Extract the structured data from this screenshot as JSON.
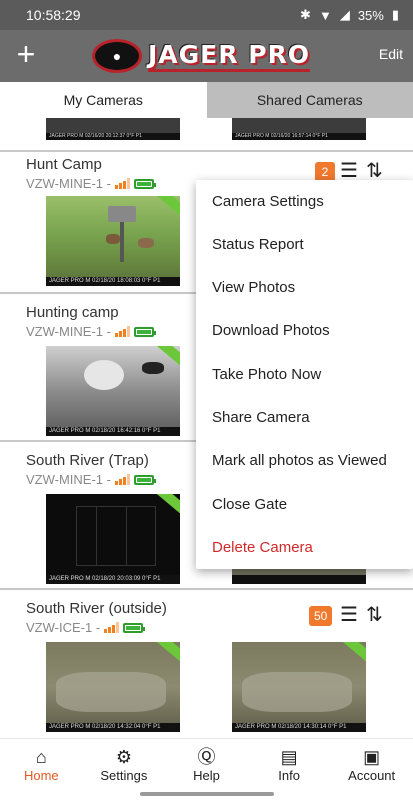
{
  "statusbar": {
    "time": "10:58:29",
    "battery": "35%",
    "icons": [
      "bluetooth-icon",
      "wifi-icon",
      "signal-icon",
      "battery-icon"
    ]
  },
  "header": {
    "add_icon": "+",
    "logo_text": "JAGER PRO",
    "edit_label": "Edit"
  },
  "tabs": [
    {
      "label": "My Cameras",
      "active": true
    },
    {
      "label": "Shared Cameras",
      "active": false
    }
  ],
  "top_thumbs": [
    {
      "caption": "JAGER PRO  M   02/16/20  20:12:37   0°F  P1"
    },
    {
      "caption": "JAGER PRO  M   02/16/20  16:57:14   0°F  P1"
    }
  ],
  "cameras": [
    {
      "name": "Hunt Camp",
      "id": "VZW-MINE-1 -",
      "photo_count": "2",
      "photos": [
        {
          "caption": "JAGER PRO  M   02/18/20  18:08:03   0°F  P1"
        }
      ]
    },
    {
      "name": "Hunting camp",
      "id": "VZW-MINE-1 -",
      "photo_count": "",
      "photos": [
        {
          "caption": "JAGER PRO  M   02/18/20  16:42:16   0°F  P1"
        }
      ]
    },
    {
      "name": "South River (Trap)",
      "id": "VZW-MINE-1 -",
      "photo_count": "",
      "photos": [
        {
          "caption": "JAGER PRO  M   02/18/20  20:03:09   0°F  P1"
        }
      ]
    },
    {
      "name": "South River (outside)",
      "id": "VZW-ICE-1 -",
      "photo_count": "50",
      "photos": [
        {
          "caption": "JAGER PRO  M   02/18/20  14:32:04   0°F  P1"
        },
        {
          "caption": "JAGER PRO  M   02/18/20  14:30:14   0°F  P1"
        }
      ]
    }
  ],
  "menu": {
    "items": [
      {
        "label": "Camera Settings"
      },
      {
        "label": "Status Report"
      },
      {
        "label": "View Photos"
      },
      {
        "label": "Download Photos"
      },
      {
        "label": "Take Photo Now"
      },
      {
        "label": "Share Camera"
      },
      {
        "label": "Mark all photos as Viewed"
      },
      {
        "label": "Close Gate"
      },
      {
        "label": "Delete Camera"
      }
    ],
    "danger_color": "#d02a2a"
  },
  "bottom_nav": [
    {
      "label": "Home",
      "icon": "home-icon",
      "active": true
    },
    {
      "label": "Settings",
      "icon": "gear-icon",
      "active": false
    },
    {
      "label": "Help",
      "icon": "help-icon",
      "active": false
    },
    {
      "label": "Info",
      "icon": "info-icon",
      "active": false
    },
    {
      "label": "Account",
      "icon": "account-icon",
      "active": false
    }
  ],
  "colors": {
    "accent": "#e25b1f",
    "badge": "#f0792d",
    "battery_green": "#3cb43c",
    "signal_orange": "#f08020",
    "header_gray": "#6c6c6c"
  }
}
